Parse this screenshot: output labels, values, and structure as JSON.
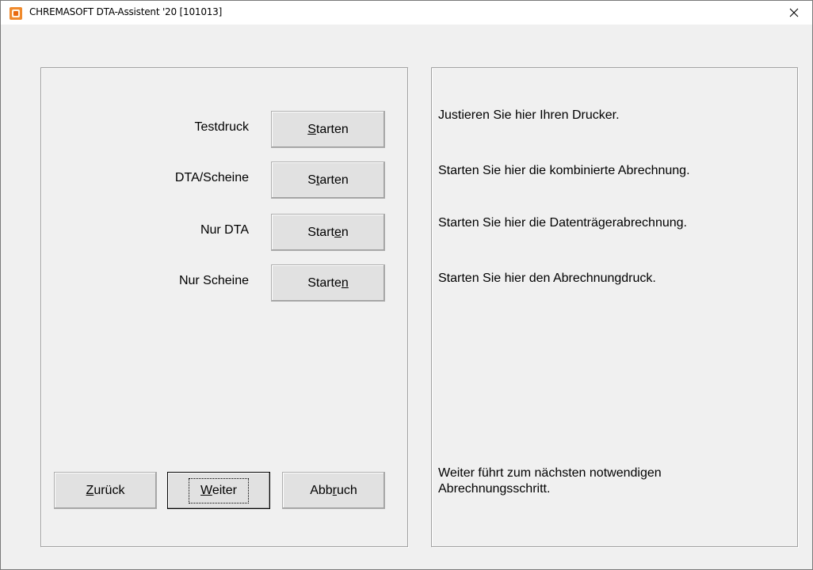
{
  "window": {
    "title": "CHREMASOFT DTA-Assistent '20 [101013]"
  },
  "rows": [
    {
      "label": "Testdruck",
      "btn_pre": "",
      "btn_ul": "S",
      "btn_post": "tarten",
      "desc": "Justieren Sie hier Ihren Drucker."
    },
    {
      "label": "DTA/Scheine",
      "btn_pre": "S",
      "btn_ul": "t",
      "btn_post": "arten",
      "desc": "Starten Sie hier die kombinierte Abrechnung."
    },
    {
      "label": "Nur DTA",
      "btn_pre": "Start",
      "btn_ul": "e",
      "btn_post": "n",
      "desc": "Starten Sie hier die Datenträgerabrechnung."
    },
    {
      "label": "Nur Scheine",
      "btn_pre": "Starte",
      "btn_ul": "n",
      "btn_post": "",
      "desc": "Starten Sie hier den Abrechnungdruck."
    }
  ],
  "nav": {
    "back": {
      "pre": "",
      "ul": "Z",
      "post": "urück"
    },
    "next": {
      "pre": "",
      "ul": "W",
      "post": "eiter"
    },
    "cancel": {
      "pre": "Abb",
      "ul": "r",
      "post": "uch"
    },
    "next_desc_line1": "Weiter führt zum nächsten notwendigen",
    "next_desc_line2": "Abrechnungsschritt."
  }
}
